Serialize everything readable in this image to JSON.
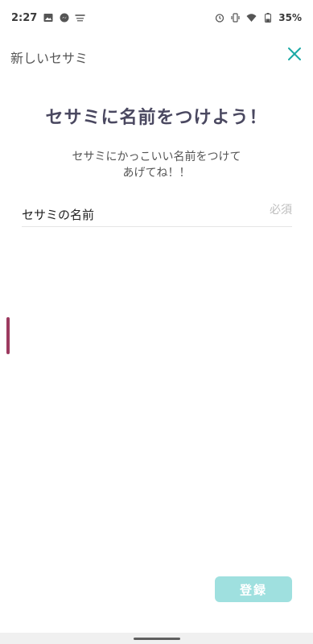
{
  "status_bar": {
    "time": "2:27",
    "battery": "35%",
    "icons_left": [
      "image-icon",
      "messenger-icon",
      "notification-icon"
    ],
    "icons_right": [
      "alarm-icon",
      "vibrate-icon",
      "wifi-icon",
      "battery-icon"
    ]
  },
  "header": {
    "title": "新しいセサミ",
    "close_icon": "close-icon",
    "accent": "#1aa9a5"
  },
  "main": {
    "title": "セサミに名前をつけよう！",
    "description_line1": "セサミにかっこいい名前をつけて",
    "description_line2": "あげてね！！"
  },
  "name_field": {
    "label": "セサミの名前",
    "required": "必須",
    "value": ""
  },
  "footer": {
    "register_label": "登録",
    "register_color": "#9fe0df"
  }
}
